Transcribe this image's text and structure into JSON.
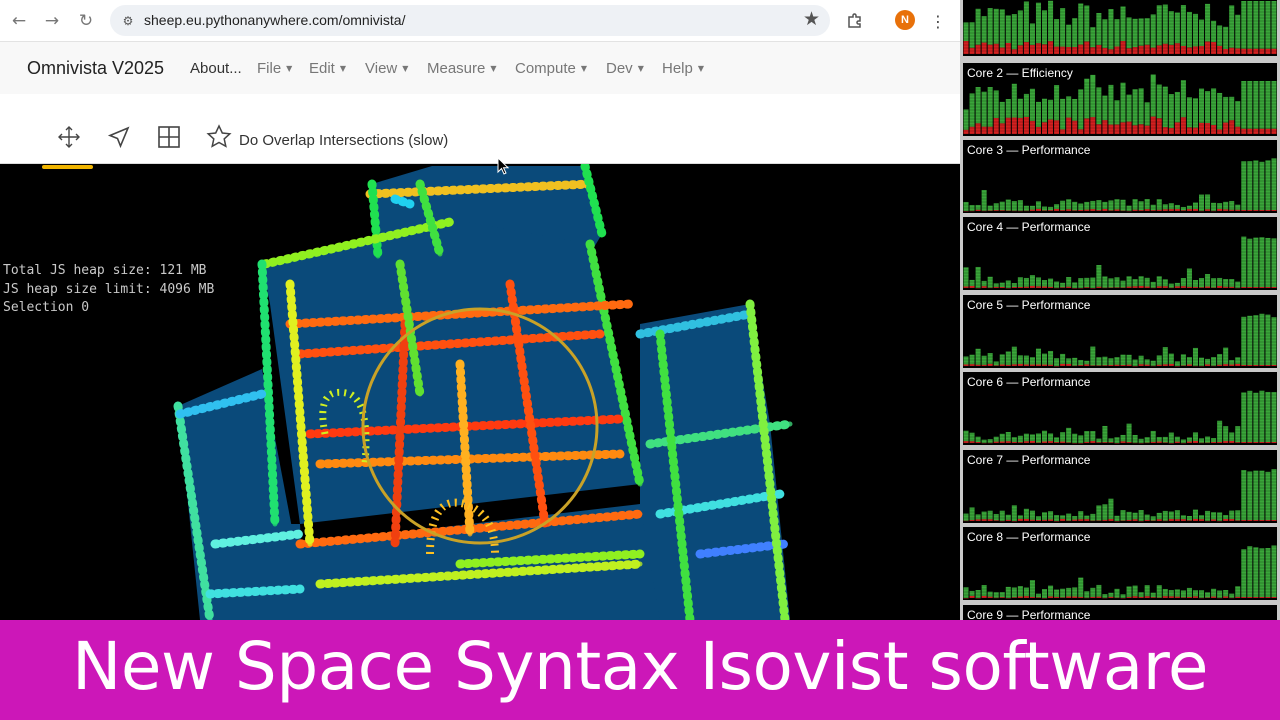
{
  "browser": {
    "url": "sheep.eu.pythonanywhere.com/omnivista/",
    "profile_initial": "N",
    "icons": [
      "back-arrow-icon",
      "forward-arrow-icon",
      "reload-icon",
      "site-info-icon",
      "bookmark-star-icon",
      "extensions-puzzle-icon",
      "kebab-menu-icon"
    ]
  },
  "app": {
    "title": "Omnivista V2025",
    "menu": [
      {
        "label": "About...",
        "has_dropdown": false
      },
      {
        "label": "File",
        "has_dropdown": true
      },
      {
        "label": "Edit",
        "has_dropdown": true
      },
      {
        "label": "View",
        "has_dropdown": true
      },
      {
        "label": "Measure",
        "has_dropdown": true
      },
      {
        "label": "Compute",
        "has_dropdown": true
      },
      {
        "label": "Dev",
        "has_dropdown": true
      },
      {
        "label": "Help",
        "has_dropdown": true
      }
    ]
  },
  "toolbar": {
    "tools": [
      "move-arrows-icon",
      "navigate-arrow-icon",
      "grid-icon",
      "star-icon"
    ],
    "active_tool": "move-arrows-icon",
    "overlap_label": "Do Overlap Intersections (slow)"
  },
  "canvas": {
    "stats": [
      "Total JS heap size: 121 MB",
      "JS heap size limit: 4096 MB",
      "Selection 0"
    ],
    "colors": {
      "background": "#000000",
      "building_fill": "#0a4a7a",
      "selection_circle": "#c9a227"
    }
  },
  "cpu_monitor": {
    "colors": {
      "user": "#3aa63a",
      "system": "#d42020",
      "background": "#000000"
    },
    "cores": [
      {
        "label": "",
        "kind": "efficiency"
      },
      {
        "label": "Core 2 — Efficiency",
        "kind": "efficiency"
      },
      {
        "label": "Core 3 — Performance",
        "kind": "performance"
      },
      {
        "label": "Core 4 — Performance",
        "kind": "performance"
      },
      {
        "label": "Core 5 — Performance",
        "kind": "performance"
      },
      {
        "label": "Core 6 — Performance",
        "kind": "performance"
      },
      {
        "label": "Core 7 — Performance",
        "kind": "performance"
      },
      {
        "label": "Core 8 — Performance",
        "kind": "performance"
      },
      {
        "label": "Core 9 — Performance",
        "kind": "performance"
      }
    ]
  },
  "caption": {
    "text": "New Space Syntax Isovist software",
    "background": "#cc17b8"
  }
}
